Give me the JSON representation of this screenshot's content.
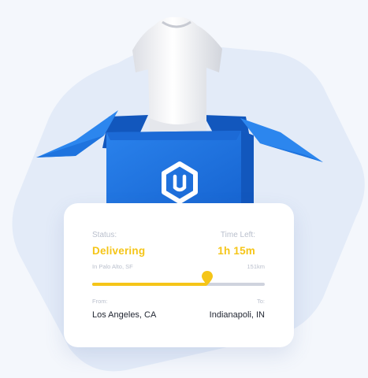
{
  "status": {
    "label": "Status:",
    "value": "Delivering",
    "location": "In Palo Alto, SF"
  },
  "time_left": {
    "label": "Time Left:",
    "value": "1h 15m",
    "distance": "151km"
  },
  "progress": {
    "fraction": 0.665
  },
  "route": {
    "from_label": "From:",
    "from_value": "Los Angeles, CA",
    "to_label": "To:",
    "to_value": "Indianapoli, IN"
  },
  "colors": {
    "accent": "#f5c518",
    "box_blue": "#1a6fd8",
    "hexagon_bg": "#e3ebf8"
  },
  "icons": {
    "box_logo": "hexagon-u-logo-icon",
    "product": "tshirt-icon",
    "pin": "location-pin-icon"
  }
}
